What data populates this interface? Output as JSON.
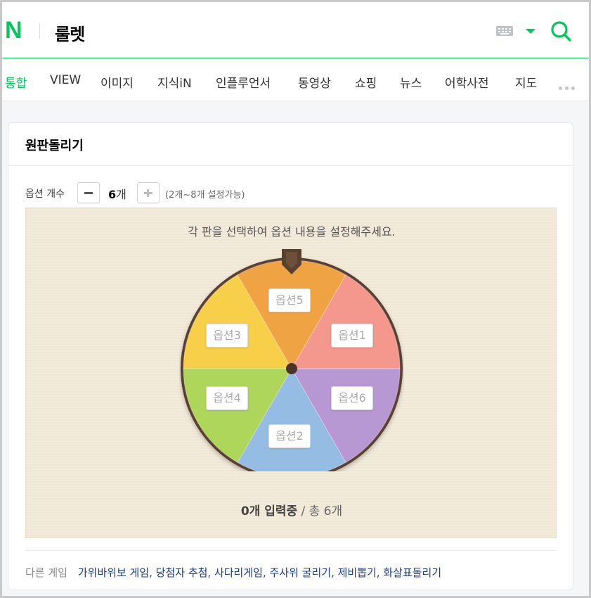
{
  "header": {
    "logo": "N",
    "query": "룰렛"
  },
  "nav": {
    "items": [
      "통합",
      "VIEW",
      "이미지",
      "지식iN",
      "인플루언서",
      "동영상",
      "쇼핑",
      "뉴스",
      "어학사전",
      "지도"
    ]
  },
  "card": {
    "title": "원판돌리기",
    "option_label": "옵션 개수",
    "option_count": "6",
    "option_count_unit": "개",
    "option_range": "(2개~8개 설정가능)",
    "board_message": "각 판을 선택하여 옵션 내용을 설정해주세요.",
    "slices": [
      {
        "label": "옵션1",
        "color": "#f4988e"
      },
      {
        "label": "옵션6",
        "color": "#b898d2"
      },
      {
        "label": "옵션2",
        "color": "#95bde4"
      },
      {
        "label": "옵션4",
        "color": "#aed65a"
      },
      {
        "label": "옵션3",
        "color": "#f7cf48"
      },
      {
        "label": "옵션5",
        "color": "#f0a343"
      }
    ],
    "status_count": "0개 입력중",
    "status_sep": " / ",
    "status_total": "총 6개",
    "other_label": "다른 게임",
    "other_games": "가위바위보 게임, 당첨자 추첨, 사다리게임, 주사위 굴리기, 제비뽑기, 화살표돌리기"
  },
  "colors": {
    "brand": "#03c75a",
    "wheel_rim": "#5a4030",
    "link": "#1a3b8c"
  }
}
